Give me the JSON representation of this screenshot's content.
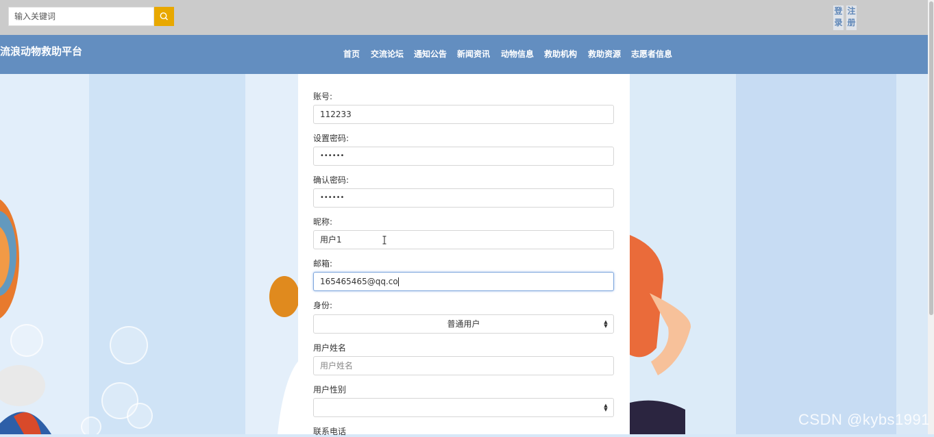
{
  "search": {
    "placeholder": "输入关键词"
  },
  "auth": {
    "login": "登录",
    "register": "注册"
  },
  "site_title": "流浪动物救助平台",
  "nav": [
    "首页",
    "交流论坛",
    "通知公告",
    "新闻资讯",
    "动物信息",
    "救助机构",
    "救助资源",
    "志愿者信息"
  ],
  "form": {
    "account_label": "账号:",
    "account_value": "112233",
    "password_label": "设置密码:",
    "password_value": "••••••",
    "confirm_label": "确认密码:",
    "confirm_value": "••••••",
    "nickname_label": "昵称:",
    "nickname_value": "用户1",
    "email_label": "邮箱:",
    "email_value": "165465465@qq.co",
    "role_label": "身份:",
    "role_value": "普通用户",
    "realname_label": "用户姓名",
    "realname_placeholder": "用户姓名",
    "gender_label": "用户性别",
    "gender_value": "",
    "phone_label": "联系电话"
  },
  "watermark": "CSDN @kybs1991",
  "colors": {
    "topbar": "#cbcbcb",
    "navbar": "#638ec0",
    "search_button": "#e8a800",
    "accent_text": "#5f87b8"
  },
  "icons": {
    "search": "search-icon",
    "select_caret": "updown-caret-icon",
    "text_cursor": "ibeam-cursor-icon"
  }
}
